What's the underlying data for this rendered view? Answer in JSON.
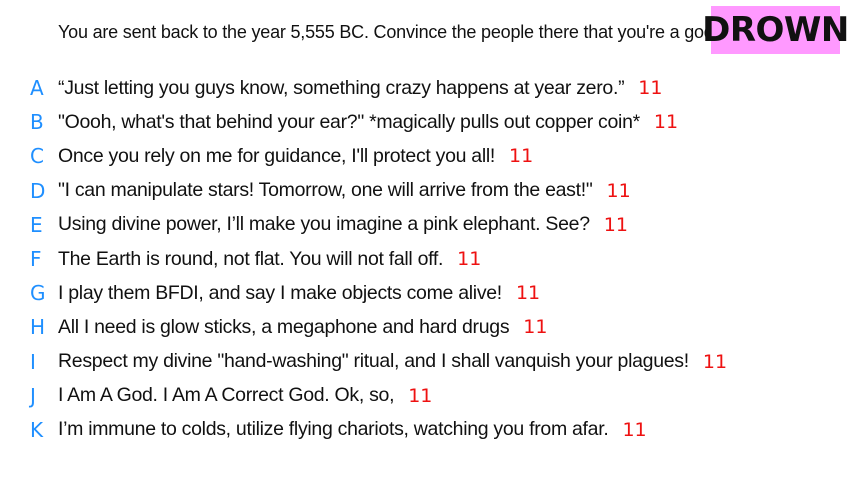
{
  "prompt": "You are sent back to the year 5,555 BC. Convince the people there that you're a god.",
  "badge": {
    "label": "DROWN",
    "color": "#ff99ff"
  },
  "colors": {
    "letter": "#1f8fff",
    "score": "#ee1111"
  },
  "entries": [
    {
      "letter": "A",
      "text": "“Just letting you guys know, something crazy happens at year zero.”",
      "score": "11"
    },
    {
      "letter": "B",
      "text": "\"Oooh, what's that behind your ear?\" *magically pulls out copper coin*",
      "score": "11"
    },
    {
      "letter": "C",
      "text": "Once you rely on me for guidance, I'll protect you all!",
      "score": "11"
    },
    {
      "letter": "D",
      "text": "\"I can manipulate stars! Tomorrow, one will arrive from the east!\"",
      "score": "11"
    },
    {
      "letter": "E",
      "text": "Using divine power, I’ll make you imagine a pink elephant. See?",
      "score": "11"
    },
    {
      "letter": "F",
      "text": "The Earth is round, not flat. You will not fall off.",
      "score": "11"
    },
    {
      "letter": "G",
      "text": "I play them BFDI, and say I make objects come alive!",
      "score": "11"
    },
    {
      "letter": "H",
      "text": "All I need is glow sticks, a megaphone and hard drugs",
      "score": "11"
    },
    {
      "letter": "I",
      "text": "Respect my divine \"hand-washing\" ritual, and I shall vanquish your plagues!",
      "score": "11"
    },
    {
      "letter": "J",
      "text": "I Am A God. I Am A Correct God. Ok, so,",
      "score": "11"
    },
    {
      "letter": "K",
      "text": "I’m immune to colds, utilize flying chariots, watching you from afar.",
      "score": "11"
    }
  ]
}
